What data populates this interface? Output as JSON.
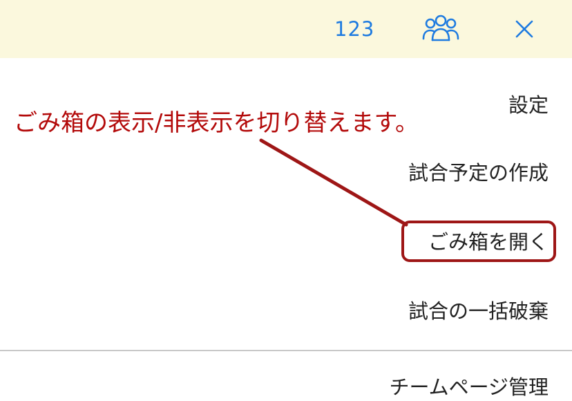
{
  "header": {
    "count": "123",
    "team_icon": "people-group-icon",
    "close_icon": "close-icon"
  },
  "menu": {
    "items": [
      {
        "label": "設定"
      },
      {
        "label": "試合予定の作成"
      },
      {
        "label": "ごみ箱を開く"
      },
      {
        "label": "試合の一括破棄"
      },
      {
        "label": "チームページ管理"
      }
    ]
  },
  "annotation": {
    "text": "ごみ箱の表示/非表示を切り替えます。",
    "color": "#b30a0a"
  },
  "colors": {
    "header_bg": "#fbf8dd",
    "accent": "#1e7be0",
    "annotation_border": "#9e1616"
  }
}
